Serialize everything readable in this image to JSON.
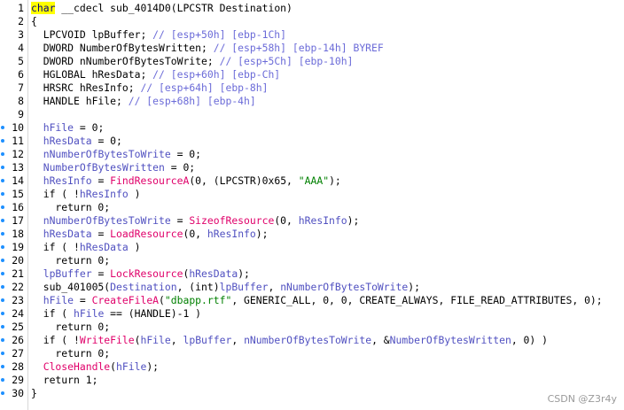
{
  "editor": {
    "lines": [
      {
        "n": "1",
        "dot": false,
        "tokens": [
          {
            "t": "char",
            "c": "kwhl"
          },
          {
            "t": " __cdecl sub_4014D0(LPCSTR Destination)",
            "c": "pl"
          }
        ]
      },
      {
        "n": "2",
        "dot": false,
        "tokens": [
          {
            "t": "{",
            "c": "pl"
          }
        ]
      },
      {
        "n": "3",
        "dot": false,
        "tokens": [
          {
            "t": "  LPCVOID lpBuffer; ",
            "c": "pl"
          },
          {
            "t": "// [esp+50h] [ebp-1Ch]",
            "c": "cm"
          }
        ]
      },
      {
        "n": "4",
        "dot": false,
        "tokens": [
          {
            "t": "  DWORD NumberOfBytesWritten; ",
            "c": "pl"
          },
          {
            "t": "// [esp+58h] [ebp-14h] BYREF",
            "c": "cm"
          }
        ]
      },
      {
        "n": "5",
        "dot": false,
        "tokens": [
          {
            "t": "  DWORD nNumberOfBytesToWrite; ",
            "c": "pl"
          },
          {
            "t": "// [esp+5Ch] [ebp-10h]",
            "c": "cm"
          }
        ]
      },
      {
        "n": "6",
        "dot": false,
        "tokens": [
          {
            "t": "  HGLOBAL hResData; ",
            "c": "pl"
          },
          {
            "t": "// [esp+60h] [ebp-Ch]",
            "c": "cm"
          }
        ]
      },
      {
        "n": "7",
        "dot": false,
        "tokens": [
          {
            "t": "  HRSRC hResInfo; ",
            "c": "pl"
          },
          {
            "t": "// [esp+64h] [ebp-8h]",
            "c": "cm"
          }
        ]
      },
      {
        "n": "8",
        "dot": false,
        "tokens": [
          {
            "t": "  HANDLE hFile; ",
            "c": "pl"
          },
          {
            "t": "// [esp+68h] [ebp-4h]",
            "c": "cm"
          }
        ]
      },
      {
        "n": "9",
        "dot": false,
        "tokens": []
      },
      {
        "n": "10",
        "dot": true,
        "tokens": [
          {
            "t": "  ",
            "c": "pl"
          },
          {
            "t": "hFile",
            "c": "var"
          },
          {
            "t": " = 0;",
            "c": "pl"
          }
        ]
      },
      {
        "n": "11",
        "dot": true,
        "tokens": [
          {
            "t": "  ",
            "c": "pl"
          },
          {
            "t": "hResData",
            "c": "var"
          },
          {
            "t": " = 0;",
            "c": "pl"
          }
        ]
      },
      {
        "n": "12",
        "dot": true,
        "tokens": [
          {
            "t": "  ",
            "c": "pl"
          },
          {
            "t": "nNumberOfBytesToWrite",
            "c": "var"
          },
          {
            "t": " = 0;",
            "c": "pl"
          }
        ]
      },
      {
        "n": "13",
        "dot": true,
        "tokens": [
          {
            "t": "  ",
            "c": "pl"
          },
          {
            "t": "NumberOfBytesWritten",
            "c": "var"
          },
          {
            "t": " = 0;",
            "c": "pl"
          }
        ]
      },
      {
        "n": "14",
        "dot": true,
        "tokens": [
          {
            "t": "  ",
            "c": "pl"
          },
          {
            "t": "hResInfo",
            "c": "var"
          },
          {
            "t": " = ",
            "c": "pl"
          },
          {
            "t": "FindResourceA",
            "c": "fn"
          },
          {
            "t": "(0, (LPCSTR)0x65, ",
            "c": "pl"
          },
          {
            "t": "\"AAA\"",
            "c": "str"
          },
          {
            "t": ");",
            "c": "pl"
          }
        ]
      },
      {
        "n": "15",
        "dot": true,
        "tokens": [
          {
            "t": "  if ( !",
            "c": "pl"
          },
          {
            "t": "hResInfo",
            "c": "var"
          },
          {
            "t": " )",
            "c": "pl"
          }
        ]
      },
      {
        "n": "16",
        "dot": true,
        "tokens": [
          {
            "t": "    return 0;",
            "c": "pl"
          }
        ]
      },
      {
        "n": "17",
        "dot": true,
        "tokens": [
          {
            "t": "  ",
            "c": "pl"
          },
          {
            "t": "nNumberOfBytesToWrite",
            "c": "var"
          },
          {
            "t": " = ",
            "c": "pl"
          },
          {
            "t": "SizeofResource",
            "c": "fn"
          },
          {
            "t": "(0, ",
            "c": "pl"
          },
          {
            "t": "hResInfo",
            "c": "var"
          },
          {
            "t": ");",
            "c": "pl"
          }
        ]
      },
      {
        "n": "18",
        "dot": true,
        "tokens": [
          {
            "t": "  ",
            "c": "pl"
          },
          {
            "t": "hResData",
            "c": "var"
          },
          {
            "t": " = ",
            "c": "pl"
          },
          {
            "t": "LoadResource",
            "c": "fn"
          },
          {
            "t": "(0, ",
            "c": "pl"
          },
          {
            "t": "hResInfo",
            "c": "var"
          },
          {
            "t": ");",
            "c": "pl"
          }
        ]
      },
      {
        "n": "19",
        "dot": true,
        "tokens": [
          {
            "t": "  if ( !",
            "c": "pl"
          },
          {
            "t": "hResData",
            "c": "var"
          },
          {
            "t": " )",
            "c": "pl"
          }
        ]
      },
      {
        "n": "20",
        "dot": true,
        "tokens": [
          {
            "t": "    return 0;",
            "c": "pl"
          }
        ]
      },
      {
        "n": "21",
        "dot": true,
        "tokens": [
          {
            "t": "  ",
            "c": "pl"
          },
          {
            "t": "lpBuffer",
            "c": "var"
          },
          {
            "t": " = ",
            "c": "pl"
          },
          {
            "t": "LockResource",
            "c": "fn"
          },
          {
            "t": "(",
            "c": "pl"
          },
          {
            "t": "hResData",
            "c": "var"
          },
          {
            "t": ");",
            "c": "pl"
          }
        ]
      },
      {
        "n": "22",
        "dot": true,
        "tokens": [
          {
            "t": "  sub_401005(",
            "c": "pl"
          },
          {
            "t": "Destination",
            "c": "var"
          },
          {
            "t": ", (int)",
            "c": "pl"
          },
          {
            "t": "lpBuffer",
            "c": "var"
          },
          {
            "t": ", ",
            "c": "pl"
          },
          {
            "t": "nNumberOfBytesToWrite",
            "c": "var"
          },
          {
            "t": ");",
            "c": "pl"
          }
        ]
      },
      {
        "n": "23",
        "dot": true,
        "tokens": [
          {
            "t": "  ",
            "c": "pl"
          },
          {
            "t": "hFile",
            "c": "var"
          },
          {
            "t": " = ",
            "c": "pl"
          },
          {
            "t": "CreateFileA",
            "c": "fn"
          },
          {
            "t": "(",
            "c": "pl"
          },
          {
            "t": "\"dbapp.rtf\"",
            "c": "str"
          },
          {
            "t": ", GENERIC_ALL, 0, 0, CREATE_ALWAYS, FILE_READ_ATTRIBUTES, 0);",
            "c": "pl"
          }
        ]
      },
      {
        "n": "24",
        "dot": true,
        "tokens": [
          {
            "t": "  if ( ",
            "c": "pl"
          },
          {
            "t": "hFile",
            "c": "var"
          },
          {
            "t": " == (HANDLE)-1 )",
            "c": "pl"
          }
        ]
      },
      {
        "n": "25",
        "dot": true,
        "tokens": [
          {
            "t": "    return 0;",
            "c": "pl"
          }
        ]
      },
      {
        "n": "26",
        "dot": true,
        "tokens": [
          {
            "t": "  if ( !",
            "c": "pl"
          },
          {
            "t": "WriteFile",
            "c": "fn"
          },
          {
            "t": "(",
            "c": "pl"
          },
          {
            "t": "hFile",
            "c": "var"
          },
          {
            "t": ", ",
            "c": "pl"
          },
          {
            "t": "lpBuffer",
            "c": "var"
          },
          {
            "t": ", ",
            "c": "pl"
          },
          {
            "t": "nNumberOfBytesToWrite",
            "c": "var"
          },
          {
            "t": ", &",
            "c": "pl"
          },
          {
            "t": "NumberOfBytesWritten",
            "c": "var"
          },
          {
            "t": ", 0) )",
            "c": "pl"
          }
        ]
      },
      {
        "n": "27",
        "dot": true,
        "tokens": [
          {
            "t": "    return 0;",
            "c": "pl"
          }
        ]
      },
      {
        "n": "28",
        "dot": true,
        "tokens": [
          {
            "t": "  ",
            "c": "pl"
          },
          {
            "t": "CloseHandle",
            "c": "fn"
          },
          {
            "t": "(",
            "c": "pl"
          },
          {
            "t": "hFile",
            "c": "var"
          },
          {
            "t": ");",
            "c": "pl"
          }
        ]
      },
      {
        "n": "29",
        "dot": true,
        "tokens": [
          {
            "t": "  return 1;",
            "c": "pl"
          }
        ]
      },
      {
        "n": "30",
        "dot": true,
        "tokens": [
          {
            "t": "}",
            "c": "pl"
          }
        ]
      }
    ]
  },
  "colors": {
    "keyword": "#000080",
    "keyword_highlight": "#ffff00",
    "comment": "#6b6bd8",
    "function": "#e0006a",
    "variable": "#5050c0",
    "string": "#008000",
    "breakpoint_dot": "#1e90ff"
  },
  "watermark": "CSDN @Z3r4y"
}
